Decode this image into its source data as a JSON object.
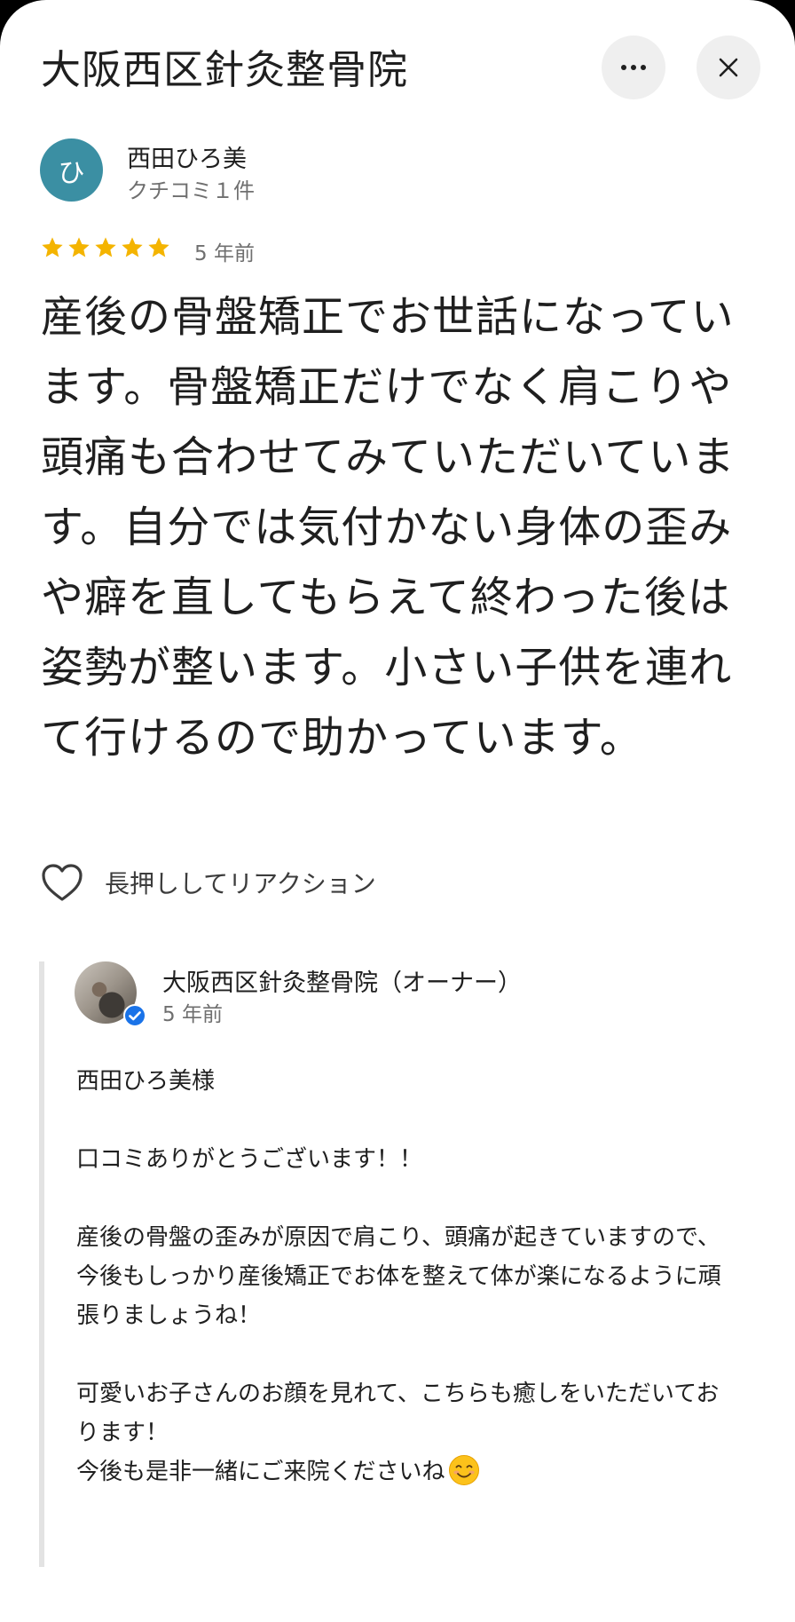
{
  "header": {
    "title": "大阪西区針灸整骨院"
  },
  "review": {
    "avatar_letter": "ひ",
    "reviewer_name": "西田ひろ美",
    "reviewer_meta": "クチコミ１件",
    "rating": 5,
    "time": "5 年前",
    "text": "産後の骨盤矯正でお世話になっています。骨盤矯正だけでなく肩こりや頭痛も合わせてみていただいています。自分では気付かない身体の歪みや癖を直してもらえて終わった後は姿勢が整います。小さい子供を連れて行けるので助かっています。"
  },
  "reaction": {
    "label": "長押ししてリアクション"
  },
  "owner_reply": {
    "name": "大阪西区針灸整骨院（オーナー）",
    "time": "5 年前",
    "p1": "西田ひろ美様",
    "p2": "口コミありがとうございます！！",
    "p3_l1": "産後の骨盤の歪みが原因で肩こり、頭痛が起きていますので、",
    "p3_l2": "今後もしっかり産後矯正でお体を整えて体が楽になるように頑張りましょうね！",
    "p4_l1": "可愛いお子さんのお顔を見れて、こちらも癒しをいただいております！",
    "p4_l2": "今後も是非一緒にご来院くださいね"
  },
  "colors": {
    "star": "#f4b400",
    "avatar_bg": "#3b8fa3",
    "verified": "#1a73e8"
  }
}
